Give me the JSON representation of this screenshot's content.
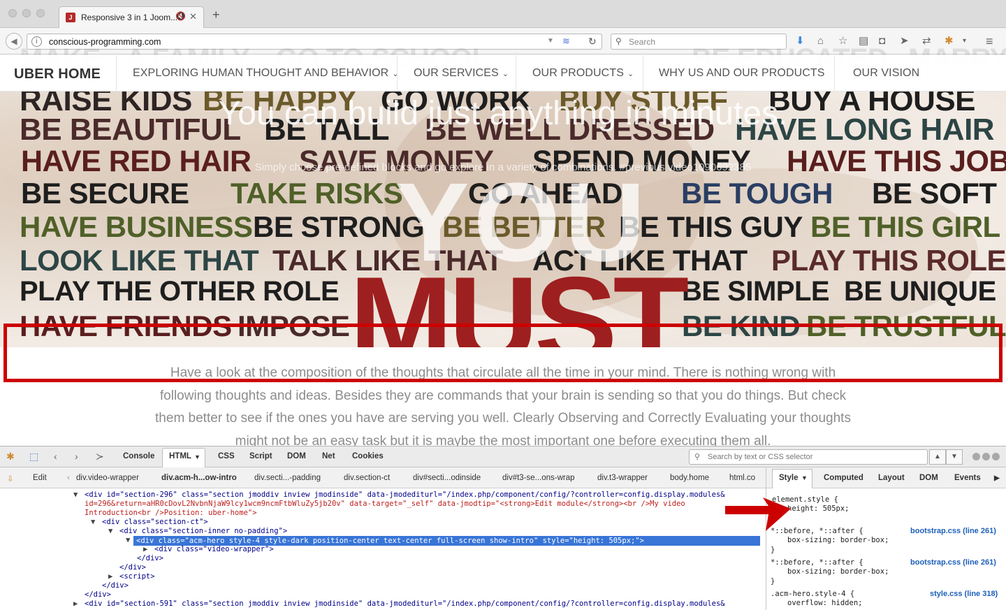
{
  "browser": {
    "tab_title": "Responsive 3 in 1 Joom...",
    "url": "conscious-programming.com",
    "search_placeholder": "Search"
  },
  "site": {
    "brand": "UBER HOME",
    "menu": [
      {
        "label": "EXPLORING HUMAN THOUGHT AND BEHAVIOR",
        "has_dropdown": true
      },
      {
        "label": "OUR SERVICES",
        "has_dropdown": true
      },
      {
        "label": "OUR PRODUCTS",
        "has_dropdown": true
      },
      {
        "label": "WHY US AND OUR PRODUCTS",
        "has_dropdown": false
      },
      {
        "label": "OUR VISION",
        "has_dropdown": false
      }
    ],
    "chevron": "⌄"
  },
  "hero": {
    "title": "You can build just anything in minutes.",
    "subtitle": "Simply choose pre-defined blocks and go explore in a variety of combinations. #previous video1090692385",
    "you": "YOU",
    "must": "MUST",
    "words": [
      {
        "text": "RAISE KIDS",
        "color": "#2d2424"
      },
      {
        "text": "BE HAPPY",
        "color": "#6b5a2a"
      },
      {
        "text": "GO WORK",
        "color": "#1e1e1e"
      },
      {
        "text": "BUY STUFF",
        "color": "#6b5a2a"
      },
      {
        "text": "BUY A HOUSE",
        "color": "#1e1e1e"
      },
      {
        "text": "BE BEAUTIFUL",
        "color": "#4a2a2a"
      },
      {
        "text": "BE TALL",
        "color": "#1e1e1e"
      },
      {
        "text": "BE WELL DRESSED",
        "color": "#4a2a2a"
      },
      {
        "text": "HAVE LONG HAIR",
        "color": "#2d4545"
      },
      {
        "text": "HAVE RED HAIR",
        "color": "#5a1e1e"
      },
      {
        "text": "SAVE MONEY",
        "color": "#4a2a2a"
      },
      {
        "text": "SPEND MONEY",
        "color": "#1e1e1e"
      },
      {
        "text": "HAVE THIS JOB",
        "color": "#5a1e1e"
      },
      {
        "text": "BE SECURE",
        "color": "#1e1e1e"
      },
      {
        "text": "TAKE RISKS",
        "color": "#4f6028"
      },
      {
        "text": "GO AHEAD",
        "color": "#1e1e1e"
      },
      {
        "text": "BE TOUGH",
        "color": "#2a3e63"
      },
      {
        "text": "BE SOFT",
        "color": "#1e1e1e"
      },
      {
        "text": "HAVE BUSINESS",
        "color": "#4f6028"
      },
      {
        "text": "BE STRONG",
        "color": "#1e1e1e"
      },
      {
        "text": "BE BETTER",
        "color": "#6b5a2a"
      },
      {
        "text": "BE THIS GUY",
        "color": "#1e1e1e"
      },
      {
        "text": "BE THIS GIRL",
        "color": "#4f6028"
      },
      {
        "text": "LOOK LIKE THAT",
        "color": "#2d4545"
      },
      {
        "text": "TALK LIKE THAT",
        "color": "#4a2a2a"
      },
      {
        "text": "ACT LIKE THAT",
        "color": "#1e1e1e"
      },
      {
        "text": "PLAY THIS ROLE",
        "color": "#5a2a2a"
      },
      {
        "text": "PLAY THE OTHER ROLE",
        "color": "#1e1e1e"
      },
      {
        "text": "BE SIMPLE",
        "color": "#1e1e1e"
      },
      {
        "text": "BE UNIQUE",
        "color": "#1e1e1e"
      },
      {
        "text": "HAVE FRIENDS",
        "color": "#5a1e1e"
      },
      {
        "text": "IMPOSE",
        "color": "#4a2a2a"
      },
      {
        "text": "BE KIND",
        "color": "#2d4545"
      },
      {
        "text": "BE TRUSTFUL",
        "color": "#4f6028"
      }
    ],
    "faded_top_words": [
      "MAKE",
      "A FAMILY",
      "GO TO SCHOOL",
      "BE EDUCATED",
      "MARRY"
    ]
  },
  "body_text": "Have a look at the composition of the thoughts that circulate all the time in your mind. There is nothing wrong with following thoughts and ideas. Besides they are commands that your brain is sending so that you do things. But check them better to see if the ones you have are serving you well. Clearly Observing and Correctly Evaluating your thoughts might not be an easy task but it is maybe the most important one before executing them all.",
  "devtools": {
    "tabs": [
      "Console",
      "HTML",
      "CSS",
      "Script",
      "DOM",
      "Net",
      "Cookies"
    ],
    "active_tab": "HTML",
    "search_placeholder": "Search by text or CSS selector",
    "edit_label": "Edit",
    "breadcrumbs": [
      "div.video-wrapper",
      "div.acm-h...ow-intro",
      "div.secti...-padding",
      "div.section-ct",
      "div#secti...odinside",
      "div#t3-se...ons-wrap",
      "div.t3-wrapper",
      "body.home",
      "html.co"
    ],
    "side_tabs": [
      "Style",
      "Computed",
      "Layout",
      "DOM",
      "Events"
    ],
    "html_lines": [
      "<div id=\"section-296\" class=\"section jmoddiv inview jmodinside\" data-jmodediturl=\"/index.php/component/config/?controller=config.display.modules&",
      "id=296&return=aHR0cDovL2NvbnNjaW9lcy1wcm9ncmFtbWluZy5jb20v\" data-target=\"_self\" data-jmodtip=\"<strong>Edit module</strong><br />My video",
      "Introduction<br />Position: uber-home\">",
      "<div class=\"section-ct\">",
      "<div class=\"section-inner no-padding\">",
      "<div class=\"acm-hero style-4 style-dark position-center text-center full-screen show-intro\" style=\"height: 505px;\">",
      "<div class=\"video-wrapper\">",
      "</div>",
      "</div>",
      "<script>",
      "</div>",
      "</div>",
      "<div id=\"section-591\" class=\"section jmoddiv inview jmodinside\" data-jmodediturl=\"/index.php/component/config/?controller=config.display.modules&"
    ],
    "styles": [
      {
        "selector": "element.style {",
        "props": [
          "height: 505px;"
        ],
        "source": ""
      },
      {
        "selector": "*::before, *::after {",
        "props": [
          "box-sizing: border-box;"
        ],
        "source": "bootstrap.css (line 261)"
      },
      {
        "selector": "*::before, *::after {",
        "props": [
          "box-sizing: border-box;"
        ],
        "source": "bootstrap.css (line 261)"
      },
      {
        "selector": ".acm-hero.style-4 {",
        "props": [
          "overflow: hidden;"
        ],
        "source": "style.css (line 318)"
      }
    ],
    "close_brace": "}"
  },
  "colors": {
    "must": "#9e1f1f",
    "annotation": "#cc0000",
    "selection": "#3875d7"
  }
}
